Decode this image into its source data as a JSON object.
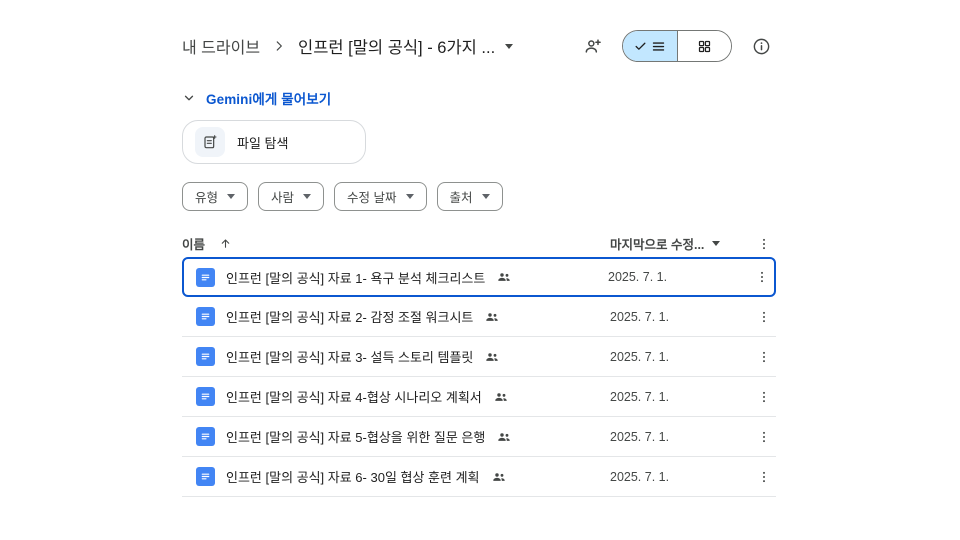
{
  "colors": {
    "accent_blue": "#0b57d0",
    "toggle_selected_bg": "#c2e7ff",
    "docs_icon_blue": "#4285f4",
    "text_primary": "#1f1f1f",
    "text_secondary": "#444746"
  },
  "header": {
    "breadcrumb_root": "내 드라이브",
    "breadcrumb_current": "인프런 [말의 공식] - 6가지 ...",
    "icons": [
      "person-add-icon",
      "list-view-icon",
      "grid-view-icon",
      "info-icon"
    ]
  },
  "gemini": {
    "ask_label": "Gemini에게 물어보기",
    "file_explore_label": "파일 탐색"
  },
  "filters": [
    {
      "label": "유형"
    },
    {
      "label": "사람"
    },
    {
      "label": "수정 날짜"
    },
    {
      "label": "출처"
    }
  ],
  "table": {
    "name_header": "이름",
    "modified_header": "마지막으로 수정...",
    "rows": [
      {
        "name": "인프런 [말의 공식] 자료 1- 욕구 분석 체크리스트",
        "date": "2025. 7. 1.",
        "selected": true
      },
      {
        "name": "인프런 [말의 공식] 자료 2- 감정 조절 워크시트",
        "date": "2025. 7. 1.",
        "selected": false
      },
      {
        "name": "인프런 [말의 공식] 자료 3- 설득 스토리 템플릿",
        "date": "2025. 7. 1.",
        "selected": false
      },
      {
        "name": "인프런 [말의 공식] 자료 4-협상 시나리오 계획서",
        "date": "2025. 7. 1.",
        "selected": false
      },
      {
        "name": "인프런 [말의 공식] 자료 5-협상을 위한 질문 은행",
        "date": "2025. 7. 1.",
        "selected": false
      },
      {
        "name": "인프런 [말의 공식] 자료 6- 30일 협상 훈련 계획",
        "date": "2025. 7. 1.",
        "selected": false
      }
    ]
  }
}
